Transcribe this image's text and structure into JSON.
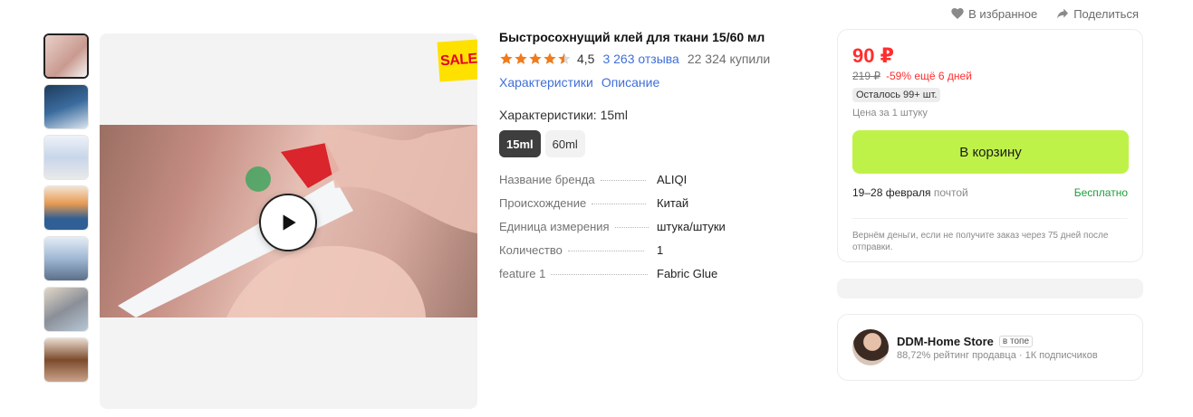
{
  "actions": {
    "favorite": "В избранное",
    "share": "Поделиться"
  },
  "badge": {
    "sale": "SALE"
  },
  "product": {
    "title": "Быстросохнущий клей для ткани 15/60 мл",
    "rating": "4,5",
    "rating_value": 4.5,
    "reviews": "3 263 отзыва",
    "bought": "22 324 купили",
    "links": [
      "Характеристики",
      "Описание"
    ],
    "characteristics_label": "Характеристики: 15ml",
    "variants": [
      {
        "label": "15ml",
        "selected": true
      },
      {
        "label": "60ml",
        "selected": false
      }
    ],
    "specs": [
      {
        "key": "Название бренда",
        "value": "ALIQI"
      },
      {
        "key": "Происхождение",
        "value": "Китай"
      },
      {
        "key": "Единица измерения",
        "value": "штука/штуки"
      },
      {
        "key": "Количество",
        "value": "1"
      },
      {
        "key": "feature 1",
        "value": "Fabric Glue"
      }
    ]
  },
  "buy": {
    "price": "90 ₽",
    "old_price": "219 ₽",
    "discount": "-59% ещё 6 дней",
    "stock": "Осталось 99+ шт.",
    "per_unit": "Цена за 1 штуку",
    "cart_button": "В корзину",
    "delivery_dates": "19–28 февраля",
    "delivery_method": "почтой",
    "delivery_cost": "Бесплатно",
    "refund_note": "Вернём деньги, если не получите заказ через 75 дней после отправки."
  },
  "store": {
    "name": "DDM-Home Store",
    "badge": "в топе",
    "stats": "88,72% рейтинг продавца · 1К подписчиков"
  },
  "colors": {
    "accent_price": "#ff2e2e",
    "link": "#3f6fd8",
    "cart_button": "#bff249",
    "star": "#f07b1b",
    "free_delivery": "#1e9e3c"
  },
  "icons": {
    "favorite": "heart-icon",
    "share": "share-arrow-icon",
    "play": "play-icon",
    "star": "star-icon"
  }
}
